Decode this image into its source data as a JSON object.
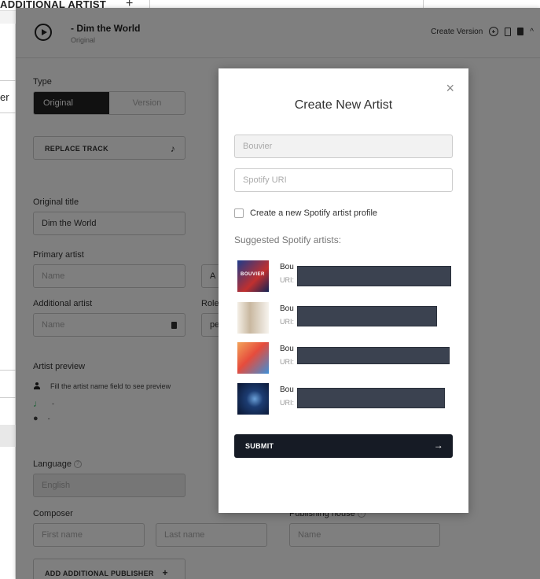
{
  "background": {
    "top_section_label": "ADDITIONAL ARTIST",
    "left_partial_label": "er",
    "track": {
      "title": "- Dim the World",
      "subtitle": "Original"
    },
    "header_actions": {
      "create_version": "Create Version"
    },
    "type": {
      "label": "Type",
      "options": [
        "Original",
        "Version"
      ],
      "selected": "Original"
    },
    "replace_track": "REPLACE TRACK",
    "original_title": {
      "label": "Original title",
      "value": "Dim the World"
    },
    "primary_artist": {
      "label": "Primary artist",
      "placeholder": "Name",
      "role_partial": "A"
    },
    "additional_artist": {
      "label": "Additional artist",
      "placeholder": "Name",
      "role_label": "Role",
      "role_partial": "pe"
    },
    "artist_preview": {
      "label": "Artist preview",
      "hint": "Fill the artist name field to see preview",
      "spotify_value": "-",
      "apple_value": "-"
    },
    "language": {
      "label": "Language",
      "value": "English"
    },
    "composer": {
      "label": "Composer",
      "first_placeholder": "First name",
      "last_placeholder": "Last name"
    },
    "publishing_house": {
      "label": "Publishing house",
      "placeholder": "Name"
    },
    "add_publisher": "ADD ADDITIONAL PUBLISHER"
  },
  "modal": {
    "title": "Create New Artist",
    "name_value": "Bouvier",
    "spotify_uri_placeholder": "Spotify URI",
    "checkbox_label": "Create a new Spotify artist profile",
    "suggested_heading": "Suggested Spotify artists:",
    "suggestions": [
      {
        "name": "Bou",
        "uri_prefix": "URI:",
        "thumb_text": "BOUVIER"
      },
      {
        "name": "Bou",
        "uri_prefix": "URI:"
      },
      {
        "name": "Bou",
        "uri_prefix": "URI:"
      },
      {
        "name": "Bou",
        "uri_prefix": "URI:"
      }
    ],
    "submit_label": "SUBMIT"
  },
  "colors": {
    "overlay": "#00000080",
    "submit_bg": "#161b25",
    "redaction": "#3b4250",
    "spotify_green": "#1db954"
  }
}
